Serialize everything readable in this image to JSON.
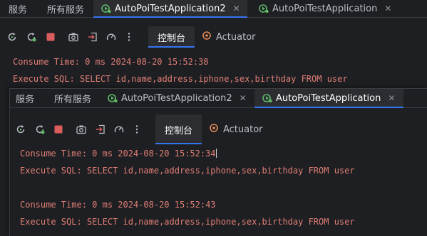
{
  "colors": {
    "background": "#1e1f22",
    "tab_active_bg": "#2b2d30",
    "accent": "#3574f0",
    "log_text": "#e07e75",
    "run_icon": "#5fb865",
    "stop_icon": "#db5c5c"
  },
  "back_window": {
    "tabs": [
      {
        "label": "服务"
      },
      {
        "label": "所有服务"
      },
      {
        "label": "AutoPoiTestApplication2",
        "icon": "run-config-icon",
        "active": true
      },
      {
        "label": "AutoPoiTestApplication",
        "icon": "run-config-icon"
      }
    ],
    "toolbar": {
      "icons": [
        "rerun-icon",
        "restart-icon",
        "stop-icon",
        "camera-icon",
        "exit-icon",
        "gauge-icon",
        "more-icon"
      ],
      "console_tab": "控制台",
      "actuator_tab": "Actuator"
    },
    "log_lines": [
      "Consume Time: 0 ms 2024-08-20 15:52:38",
      "Execute SQL: SELECT id,name,address,iphone,sex,birthday FROM user"
    ]
  },
  "front_window": {
    "tabs": [
      {
        "label": "服务"
      },
      {
        "label": "所有服务"
      },
      {
        "label": "AutoPoiTestApplication2",
        "icon": "run-config-icon"
      },
      {
        "label": "AutoPoiTestApplication",
        "icon": "run-config-icon",
        "active": true
      }
    ],
    "toolbar": {
      "icons": [
        "rerun-icon",
        "restart-icon",
        "stop-icon",
        "camera-icon",
        "exit-icon",
        "gauge-icon",
        "more-icon"
      ],
      "console_tab": "控制台",
      "actuator_tab": "Actuator"
    },
    "log_lines": [
      "Consume Time: 0 ms 2024-08-20 15:52:34",
      "Execute SQL: SELECT id,name,address,iphone,sex,birthday FROM user",
      "",
      "Consume Time: 0 ms 2024-08-20 15:52:43",
      "Execute SQL: SELECT id,name,address,iphone,sex,birthday FROM user"
    ]
  }
}
